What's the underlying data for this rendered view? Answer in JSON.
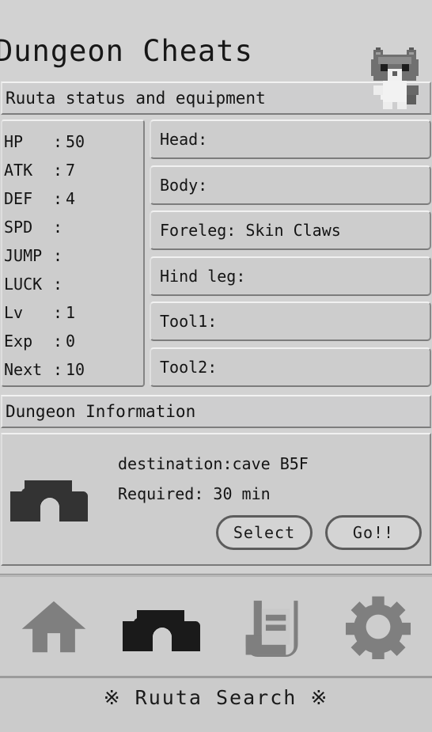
{
  "header": {
    "title": "Dungeon Cheats",
    "mascot_icon": "cat-mascot-icon"
  },
  "status_section": {
    "title": "Ruuta status and equipment",
    "stats": [
      {
        "label": "HP",
        "colon": ":",
        "value": "50"
      },
      {
        "label": "ATK",
        "colon": ":",
        "value": "7"
      },
      {
        "label": "DEF",
        "colon": ":",
        "value": "4"
      },
      {
        "label": "SPD",
        "colon": ":",
        "value": ""
      },
      {
        "label": "JUMP",
        "colon": ":",
        "value": ""
      },
      {
        "label": "LUCK",
        "colon": ":",
        "value": ""
      },
      {
        "label": "Lv",
        "colon": ":",
        "value": "1"
      },
      {
        "label": "Exp",
        "colon": ":",
        "value": "0"
      },
      {
        "label": "Next",
        "colon": ":",
        "value": "10"
      }
    ],
    "equipment": [
      {
        "slot": "Head:",
        "text": "Head:"
      },
      {
        "slot": "Body:",
        "text": "Body:"
      },
      {
        "slot": "Foreleg:",
        "text": "Foreleg: Skin Claws"
      },
      {
        "slot": "Hind leg:",
        "text": "Hind leg:"
      },
      {
        "slot": "Tool1:",
        "text": "Tool1:"
      },
      {
        "slot": "Tool2:",
        "text": "Tool2:"
      }
    ]
  },
  "dungeon_section": {
    "title": "Dungeon Information",
    "cave_icon": "cave-icon",
    "destination": "destination:cave B5F",
    "required": "Required: 30 min",
    "select_label": "Select",
    "go_label": "Go!!"
  },
  "navbar": {
    "items": [
      {
        "icon": "home-icon",
        "name": "nav-home",
        "active": false
      },
      {
        "icon": "cave-icon",
        "name": "nav-dungeon",
        "active": true
      },
      {
        "icon": "scroll-icon",
        "name": "nav-log",
        "active": false
      },
      {
        "icon": "gear-icon",
        "name": "nav-settings",
        "active": false
      }
    ]
  },
  "footer": {
    "text": "※ Ruuta Search ※"
  },
  "colors": {
    "background": "#d2d2d2",
    "panel": "#cdcdcd",
    "text": "#141414",
    "icon_inactive": "#7f7f7f",
    "icon_active": "#1f1f1f",
    "button_border": "#5c5c5c"
  }
}
